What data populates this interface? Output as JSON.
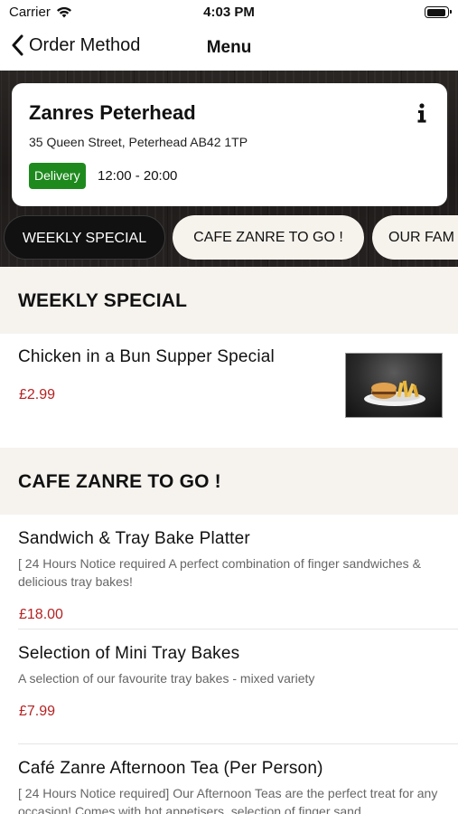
{
  "status_bar": {
    "carrier": "Carrier",
    "time": "4:03 PM"
  },
  "nav": {
    "back_label": "Order Method",
    "title": "Menu"
  },
  "restaurant": {
    "name": "Zanres Peterhead",
    "address": "35 Queen Street, Peterhead AB42 1TP",
    "order_type": "Delivery",
    "hours": "12:00 - 20:00",
    "badge_color": "#1e8a1e"
  },
  "categories": [
    {
      "label": "WEEKLY SPECIAL",
      "active": true
    },
    {
      "label": "CAFE ZANRE TO GO !",
      "active": false
    },
    {
      "label": "OUR FAM",
      "active": false
    }
  ],
  "sections": [
    {
      "title": "WEEKLY SPECIAL",
      "items": [
        {
          "name": "Chicken in a Bun Supper Special",
          "price": "£2.99",
          "has_image": true
        }
      ]
    },
    {
      "title": "CAFE ZANRE TO GO !",
      "items": [
        {
          "name": "Sandwich & Tray Bake Platter",
          "description": "[ 24 Hours Notice required A perfect combination of finger sandwiches & delicious tray bakes!",
          "price": "£18.00"
        },
        {
          "name": "Selection of Mini Tray Bakes",
          "description": "A selection of our favourite tray bakes - mixed variety",
          "price": "£7.99"
        },
        {
          "name": "Café Zanre Afternoon Tea (Per Person)",
          "description": "[ 24 Hours Notice required] Our Afternoon Teas are the perfect treat for any occasion! Comes with hot appetisers, selection of finger sand"
        }
      ]
    }
  ],
  "colors": {
    "price": "#b52222",
    "section_bg": "#f6f3ef",
    "pill_active_bg": "#111111",
    "pill_inactive_bg": "#f6f2ec"
  },
  "icons": {
    "back": "chevron-left-icon",
    "info": "info-icon",
    "wifi": "wifi-icon",
    "battery": "battery-icon"
  }
}
